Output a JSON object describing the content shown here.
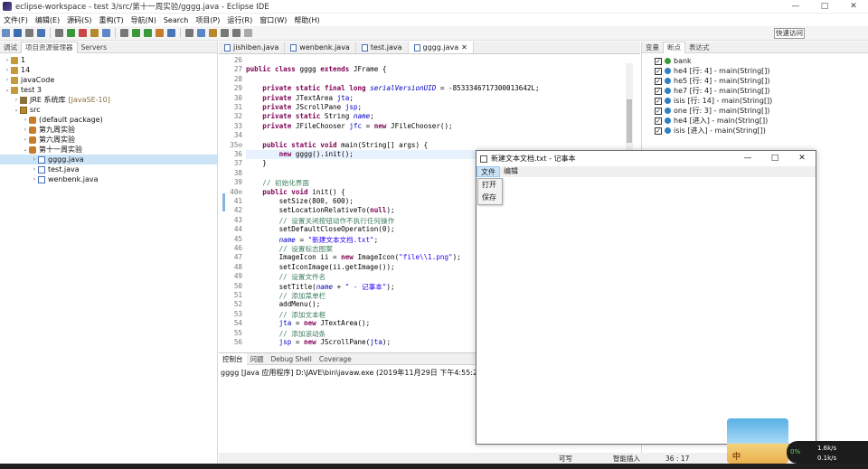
{
  "window": {
    "title": "eclipse-workspace - test 3/src/第十一周实验/gggg.java - Eclipse IDE",
    "min": "—",
    "max": "□",
    "close": "✕"
  },
  "menubar": [
    "文件(F)",
    "编辑(E)",
    "源码(S)",
    "重构(T)",
    "导航(N)",
    "Search",
    "项目(P)",
    "运行(R)",
    "窗口(W)",
    "帮助(H)"
  ],
  "quick_access": "快速访问",
  "left_tabs": [
    "调试",
    "项目资源管理器",
    "Servers"
  ],
  "project_tree": [
    {
      "label": "1",
      "indent": 0,
      "twisty": "›",
      "icon": "proj"
    },
    {
      "label": "14",
      "indent": 0,
      "twisty": "›",
      "icon": "proj"
    },
    {
      "label": "javaCode",
      "indent": 0,
      "twisty": "›",
      "icon": "proj"
    },
    {
      "label": "test 3",
      "indent": 0,
      "twisty": "⌄",
      "icon": "proj"
    },
    {
      "label": "JRE 系统库",
      "suffix": "[JavaSE-10]",
      "indent": 1,
      "twisty": "›",
      "icon": "lib"
    },
    {
      "label": "src",
      "indent": 1,
      "twisty": "⌄",
      "icon": "src"
    },
    {
      "label": "(default package)",
      "indent": 2,
      "twisty": "›",
      "icon": "pkg"
    },
    {
      "label": "第九周实验",
      "indent": 2,
      "twisty": "›",
      "icon": "pkg"
    },
    {
      "label": "第六周实验",
      "indent": 2,
      "twisty": "›",
      "icon": "pkg"
    },
    {
      "label": "第十一周实验",
      "indent": 2,
      "twisty": "⌄",
      "icon": "pkg"
    },
    {
      "label": "gggg.java",
      "indent": 3,
      "twisty": "›",
      "icon": "java",
      "selected": true
    },
    {
      "label": "test.java",
      "indent": 3,
      "twisty": "›",
      "icon": "java"
    },
    {
      "label": "wenbenk.java",
      "indent": 3,
      "twisty": "›",
      "icon": "java"
    }
  ],
  "editor_tabs": [
    {
      "label": "jishiben.java",
      "active": false
    },
    {
      "label": "wenbenk.java",
      "active": false
    },
    {
      "label": "test.java",
      "active": false
    },
    {
      "label": "gggg.java",
      "active": true
    }
  ],
  "code_lines": [
    {
      "n": "26",
      "segs": [
        {
          "t": ""
        }
      ]
    },
    {
      "n": "27",
      "segs": [
        {
          "t": "public class ",
          "c": "kw"
        },
        {
          "t": "gggg "
        },
        {
          "t": "extends ",
          "c": "kw"
        },
        {
          "t": "JFrame {"
        }
      ]
    },
    {
      "n": "28",
      "segs": [
        {
          "t": ""
        }
      ]
    },
    {
      "n": "29",
      "segs": [
        {
          "t": "    "
        },
        {
          "t": "private static final long ",
          "c": "kw"
        },
        {
          "t": "serialVersionUID",
          "c": "fldi"
        },
        {
          "t": " = -8533346717300013642L;"
        }
      ]
    },
    {
      "n": "30",
      "segs": [
        {
          "t": "    "
        },
        {
          "t": "private ",
          "c": "kw"
        },
        {
          "t": "JTextArea "
        },
        {
          "t": "jta",
          "c": "fld"
        },
        {
          "t": ";"
        }
      ]
    },
    {
      "n": "31",
      "segs": [
        {
          "t": "    "
        },
        {
          "t": "private ",
          "c": "kw"
        },
        {
          "t": "JScrollPane "
        },
        {
          "t": "jsp",
          "c": "fld"
        },
        {
          "t": ";"
        }
      ]
    },
    {
      "n": "32",
      "segs": [
        {
          "t": "    "
        },
        {
          "t": "private static ",
          "c": "kw"
        },
        {
          "t": "String "
        },
        {
          "t": "name",
          "c": "fldi"
        },
        {
          "t": ";"
        }
      ]
    },
    {
      "n": "33",
      "segs": [
        {
          "t": "    "
        },
        {
          "t": "private ",
          "c": "kw"
        },
        {
          "t": "JFileChooser "
        },
        {
          "t": "jfc",
          "c": "fld"
        },
        {
          "t": " = "
        },
        {
          "t": "new ",
          "c": "kw"
        },
        {
          "t": "JFileChooser();"
        }
      ]
    },
    {
      "n": "34",
      "segs": [
        {
          "t": ""
        }
      ]
    },
    {
      "n": "35⊖",
      "segs": [
        {
          "t": "    "
        },
        {
          "t": "public static void ",
          "c": "kw"
        },
        {
          "t": "main(String[] args) {"
        }
      ]
    },
    {
      "n": "36",
      "segs": [
        {
          "t": "        "
        },
        {
          "t": "new ",
          "c": "kw"
        },
        {
          "t": "gggg().init();"
        }
      ],
      "hl": true
    },
    {
      "n": "37",
      "segs": [
        {
          "t": "    }"
        }
      ]
    },
    {
      "n": "38",
      "segs": [
        {
          "t": ""
        }
      ]
    },
    {
      "n": "39",
      "segs": [
        {
          "t": "    "
        },
        {
          "t": "// 初始化界面",
          "c": "cm"
        }
      ]
    },
    {
      "n": "40⊖",
      "segs": [
        {
          "t": "    "
        },
        {
          "t": "public void ",
          "c": "kw"
        },
        {
          "t": "init() {"
        }
      ]
    },
    {
      "n": "41",
      "segs": [
        {
          "t": "        setSize(800, 600);"
        }
      ]
    },
    {
      "n": "42",
      "segs": [
        {
          "t": "        setLocationRelativeTo("
        },
        {
          "t": "null",
          "c": "kw"
        },
        {
          "t": ");"
        }
      ]
    },
    {
      "n": "43",
      "segs": [
        {
          "t": "        "
        },
        {
          "t": "// 设置关闭按钮动作不执行任何操作",
          "c": "cm"
        }
      ]
    },
    {
      "n": "44",
      "segs": [
        {
          "t": "        setDefaultCloseOperation(0);"
        }
      ]
    },
    {
      "n": "45",
      "segs": [
        {
          "t": "        "
        },
        {
          "t": "name",
          "c": "fldi"
        },
        {
          "t": " = "
        },
        {
          "t": "\"新建文本文档.txt\"",
          "c": "str"
        },
        {
          "t": ";"
        }
      ]
    },
    {
      "n": "46",
      "segs": [
        {
          "t": "        "
        },
        {
          "t": "// 设置标志图案",
          "c": "cm"
        }
      ]
    },
    {
      "n": "47",
      "segs": [
        {
          "t": "        ImageIcon ii = "
        },
        {
          "t": "new ",
          "c": "kw"
        },
        {
          "t": "ImageIcon("
        },
        {
          "t": "\"file\\\\1.png\"",
          "c": "str"
        },
        {
          "t": ");"
        }
      ]
    },
    {
      "n": "48",
      "segs": [
        {
          "t": "        setIconImage(ii.getImage());"
        }
      ]
    },
    {
      "n": "49",
      "segs": [
        {
          "t": "        "
        },
        {
          "t": "// 设置文件名",
          "c": "cm"
        }
      ]
    },
    {
      "n": "50",
      "segs": [
        {
          "t": "        setTitle("
        },
        {
          "t": "name",
          "c": "fldi"
        },
        {
          "t": " + "
        },
        {
          "t": "\" - 记事本\"",
          "c": "str"
        },
        {
          "t": ");"
        }
      ]
    },
    {
      "n": "51",
      "segs": [
        {
          "t": "        "
        },
        {
          "t": "// 添加菜单栏",
          "c": "cm"
        }
      ]
    },
    {
      "n": "52",
      "segs": [
        {
          "t": "        addMenu();"
        }
      ]
    },
    {
      "n": "53",
      "segs": [
        {
          "t": "        "
        },
        {
          "t": "// 添加文本框",
          "c": "cm"
        }
      ]
    },
    {
      "n": "54",
      "segs": [
        {
          "t": "        "
        },
        {
          "t": "jta",
          "c": "fld"
        },
        {
          "t": " = "
        },
        {
          "t": "new ",
          "c": "kw"
        },
        {
          "t": "JTextArea();"
        }
      ]
    },
    {
      "n": "55",
      "segs": [
        {
          "t": "        "
        },
        {
          "t": "// 添加滚动条",
          "c": "cm"
        }
      ]
    },
    {
      "n": "56",
      "segs": [
        {
          "t": "        "
        },
        {
          "t": "jsp",
          "c": "fld"
        },
        {
          "t": " = "
        },
        {
          "t": "new ",
          "c": "kw"
        },
        {
          "t": "JScrollPane("
        },
        {
          "t": "jta",
          "c": "fld"
        },
        {
          "t": ");"
        }
      ]
    }
  ],
  "console": {
    "tabs": [
      "控制台",
      "问题",
      "Debug Shell",
      "Coverage"
    ],
    "line": "gggg [Java 应用程序] D:\\JAVE\\bin\\javaw.exe  (2019年11月29日 下午4:55:28)"
  },
  "right_tabs": [
    "变量",
    "断点",
    "表达式"
  ],
  "breakpoints": [
    {
      "label": "bank",
      "icon": "grn"
    },
    {
      "label": "he4 [行:  4] - main(String[])",
      "icon": "blue"
    },
    {
      "label": "he5 [行:  4] - main(String[])",
      "icon": "blue"
    },
    {
      "label": "he7 [行:  4] - main(String[])",
      "icon": "blue"
    },
    {
      "label": "isis [行:  14] - main(String[])",
      "icon": "blue"
    },
    {
      "label": "one [行:  3] - main(String[])",
      "icon": "blue"
    },
    {
      "label": "he4 [进入] - main(String[])",
      "icon": "blue"
    },
    {
      "label": "isis [进入] - main(String[])",
      "icon": "blue"
    }
  ],
  "notepad": {
    "title": "新建文本文档.txt - 记事本",
    "menu": [
      "文件",
      "编辑"
    ],
    "dropdown": [
      "打开",
      "保存"
    ]
  },
  "statusbar": {
    "writable": "可写",
    "insert": "智能插入",
    "pos": "36 : 17"
  },
  "widget": {
    "text": "中",
    "gauge_top": "1.6k/s",
    "gauge_bottom": "0.1k/s",
    "percent": "0%"
  },
  "colors": {
    "keyword": "#7f0055",
    "field": "#0000c0",
    "string": "#2a00ff",
    "comment": "#3f7f5f",
    "selection": "#cce4f7"
  }
}
